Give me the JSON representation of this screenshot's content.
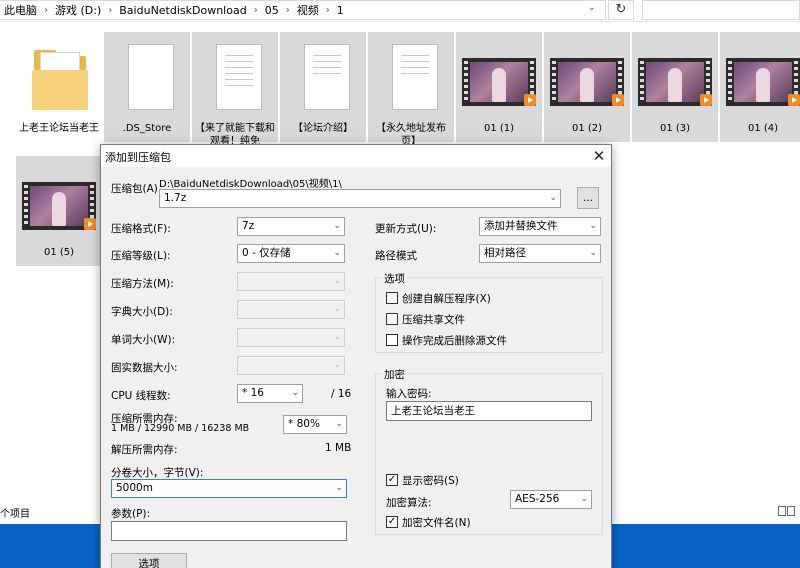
{
  "address": {
    "crumbs": [
      "此电脑",
      "游戏 (D:)",
      "BaiduNetdiskDownload",
      "05",
      "视频",
      "1"
    ]
  },
  "files": [
    {
      "label": "上老王论坛当老王",
      "kind": "folder"
    },
    {
      "label": ".DS_Store",
      "kind": "doc"
    },
    {
      "label": "【来了就能下载和观看！纯免",
      "kind": "doc"
    },
    {
      "label": "【论坛介绍】",
      "kind": "doc"
    },
    {
      "label": "【永久地址发布页】",
      "kind": "doc"
    },
    {
      "label": "01 (1)",
      "kind": "video"
    },
    {
      "label": "01 (2)",
      "kind": "video"
    },
    {
      "label": "01 (3)",
      "kind": "video"
    },
    {
      "label": "01 (4)",
      "kind": "video"
    },
    {
      "label": "01 (5)",
      "kind": "video"
    }
  ],
  "status": {
    "count_text": "个项目"
  },
  "dialog": {
    "title": "添加到压缩包",
    "archive_label": "压缩包(A)",
    "archive_path": "D:\\BaiduNetdiskDownload\\05\\视频\\1\\",
    "archive_name": "1.7z",
    "browse_label": "...",
    "format_label": "压缩格式(F):",
    "format_value": "7z",
    "level_label": "压缩等级(L):",
    "level_value": "0 - 仅存储",
    "method_label": "压缩方法(M):",
    "dict_label": "字典大小(D):",
    "word_label": "单词大小(W):",
    "solid_label": "固实数据大小:",
    "cpu_label": "CPU 线程数:",
    "cpu_value": "* 16",
    "cpu_total": "/ 16",
    "mem_label": "压缩所需内存:",
    "mem_detail": "1 MB / 12990 MB / 16238 MB",
    "mem_value": "* 80%",
    "decomp_label": "解压所需内存:",
    "decomp_value": "1 MB",
    "volume_label": "分卷大小，字节(V):",
    "volume_value": "5000m",
    "params_label": "参数(P):",
    "params_value": "",
    "options_button": "选项",
    "update_label": "更新方式(U):",
    "update_value": "添加并替换文件",
    "pathmode_label": "路径模式",
    "pathmode_value": "相对路径",
    "options_group": "选项",
    "opt_sfx": "创建自解压程序(X)",
    "opt_shared": "压缩共享文件",
    "opt_delete": "操作完成后删除源文件",
    "enc_group": "加密",
    "pwd_label": "输入密码:",
    "pwd_value": "上老王论坛当老王",
    "show_pwd": "显示密码(S)",
    "enc_method_label": "加密算法:",
    "enc_method_value": "AES-256",
    "enc_names": "加密文件名(N)",
    "check": "✓"
  }
}
